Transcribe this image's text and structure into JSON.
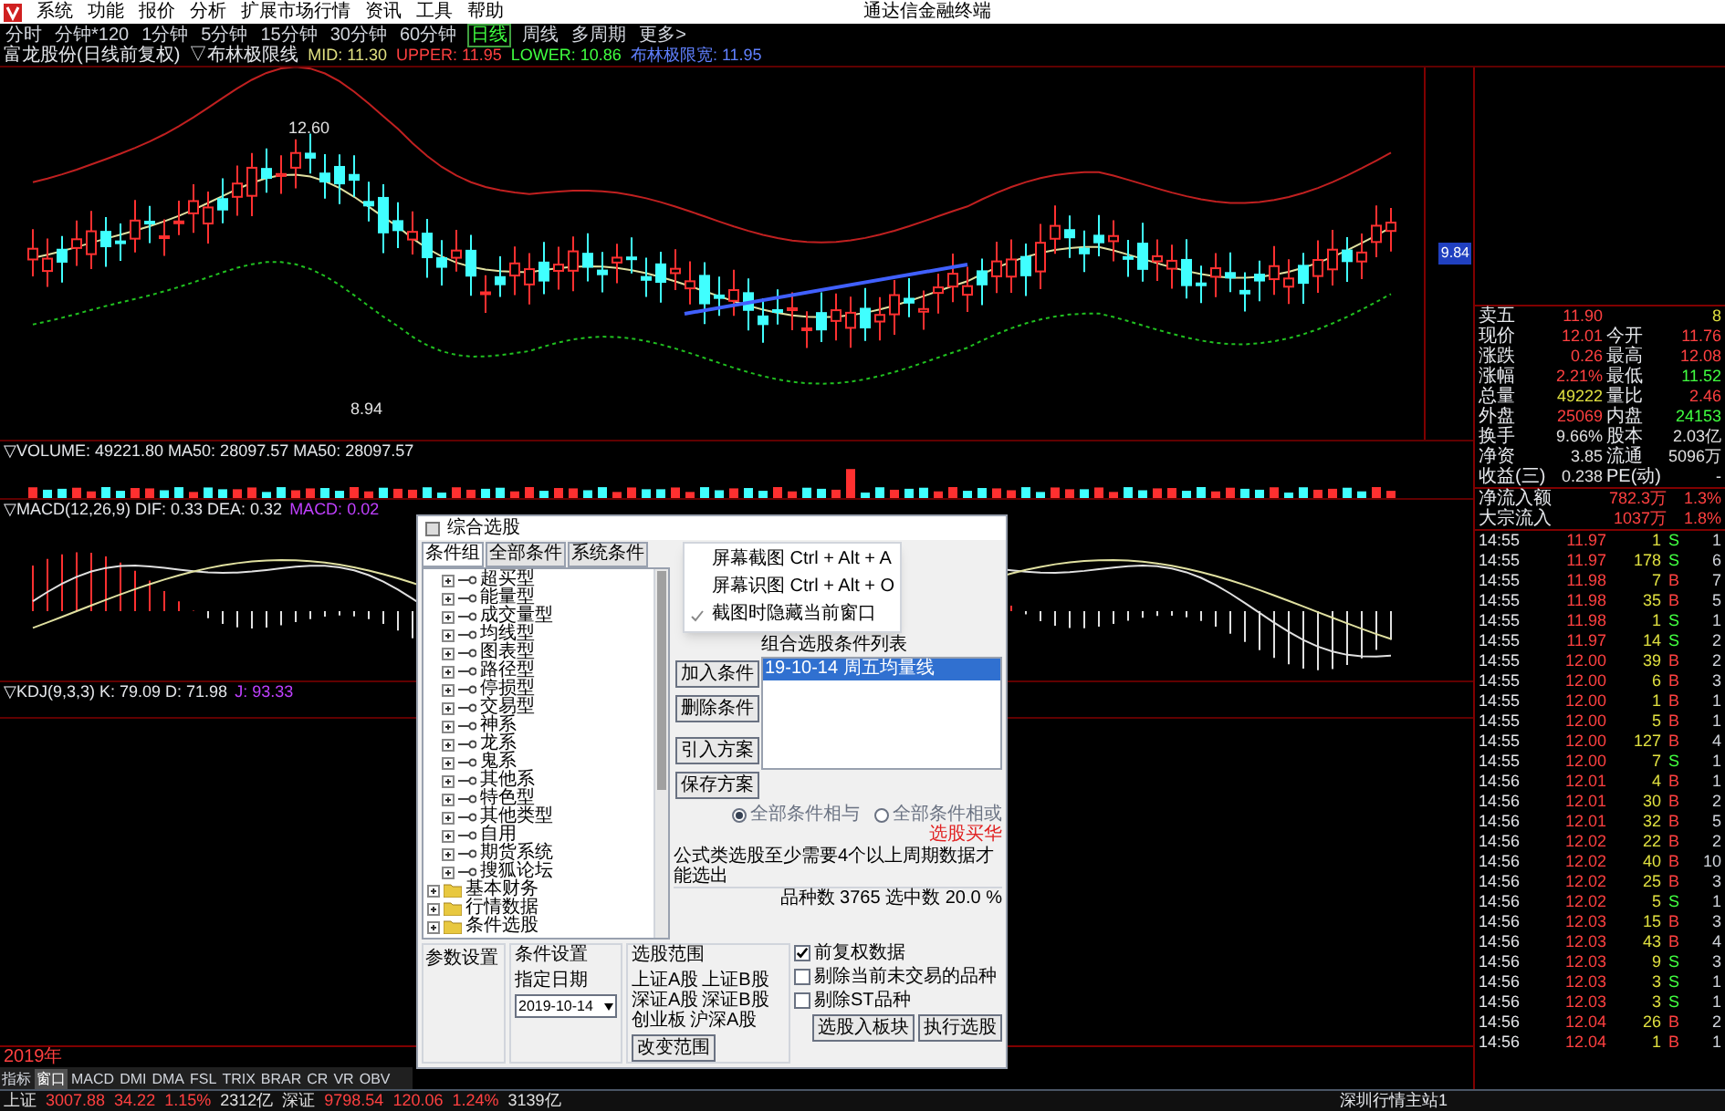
{
  "menu": {
    "items": [
      "系统",
      "功能",
      "报价",
      "分析",
      "扩展市场行情",
      "资讯",
      "工具",
      "帮助"
    ],
    "app_title": "通达信金融终端"
  },
  "periods": [
    {
      "label": "分时",
      "selected": false
    },
    {
      "label": "分钟*120",
      "selected": false
    },
    {
      "label": "1分钟",
      "selected": false
    },
    {
      "label": "5分钟",
      "selected": false
    },
    {
      "label": "15分钟",
      "selected": false
    },
    {
      "label": "30分钟",
      "selected": false
    },
    {
      "label": "60分钟",
      "selected": false
    },
    {
      "label": "日线",
      "selected": true
    },
    {
      "label": "周线",
      "selected": false
    },
    {
      "label": "多周期",
      "selected": false
    },
    {
      "label": "更多>",
      "selected": false
    }
  ],
  "indicator_bar": {
    "stock": "富龙股份(日线前复权)",
    "indicator": "▽布林极限线",
    "values": [
      {
        "text": "MID: 11.30",
        "color": "#e0e080"
      },
      {
        "text": "UPPER: 11.95",
        "color": "#ff4040"
      },
      {
        "text": "LOWER: 10.86",
        "color": "#40ff40"
      },
      {
        "text": "布林极限宽: 11.95",
        "color": "#6080ff"
      }
    ]
  },
  "chart": {
    "high_label": "12.60",
    "low_label": "8.94",
    "marker": "9.84"
  },
  "volume_pane": {
    "title": "▽VOLUME: 49221.80  MA50: 28097.57  MA50: 28097.57"
  },
  "macd_pane": {
    "title": "▽MACD(12,26,9) DIF: 0.33 DEA: 0.32",
    "value": "MACD: 0.02"
  },
  "kdj_pane": {
    "title": "▽KDJ(9,3,3) K: 79.09 D: 71.98",
    "value": "J: 93.33"
  },
  "date_axis": "2019年",
  "indicator_tabs": [
    {
      "label": "指标",
      "selected": false
    },
    {
      "label": "窗口",
      "selected": true
    },
    {
      "label": "MACD",
      "selected": false
    },
    {
      "label": "DMI",
      "selected": false
    },
    {
      "label": "DMA",
      "selected": false
    },
    {
      "label": "FSL",
      "selected": false
    },
    {
      "label": "TRIX",
      "selected": false
    },
    {
      "label": "BRAR",
      "selected": false
    },
    {
      "label": "CR",
      "selected": false
    },
    {
      "label": "VR",
      "selected": false
    },
    {
      "label": "OBV",
      "selected": false
    }
  ],
  "status_bar": {
    "items": [
      {
        "text": "上证",
        "color": "#e0e0e0"
      },
      {
        "text": "3007.88",
        "color": "#ff4040"
      },
      {
        "text": "34.22",
        "color": "#ff4040"
      },
      {
        "text": "1.15%",
        "color": "#ff4040"
      },
      {
        "text": "2312亿",
        "color": "#e0e0e0"
      },
      {
        "text": "深证",
        "color": "#e0e0e0"
      },
      {
        "text": "9798.54",
        "color": "#ff4040"
      },
      {
        "text": "120.06",
        "color": "#ff4040"
      },
      {
        "text": "1.24%",
        "color": "#ff4040"
      },
      {
        "text": "3139亿",
        "color": "#e0e0e0"
      }
    ],
    "server": "深圳行情主站1"
  },
  "quote": [
    {
      "label": "卖五",
      "value": {
        "text": "11.90",
        "color": "#ff4040"
      },
      "value2": {
        "text": "8",
        "color": "#e0e040"
      }
    },
    {
      "label": "现价",
      "value": {
        "text": "12.01",
        "color": "#ff4040"
      },
      "label2": "今开",
      "value2": {
        "text": "11.76",
        "color": "#ff4040"
      }
    },
    {
      "label": "涨跌",
      "value": {
        "text": "0.26",
        "color": "#ff4040"
      },
      "label2": "最高",
      "value2": {
        "text": "12.08",
        "color": "#ff4040"
      }
    },
    {
      "label": "涨幅",
      "value": {
        "text": "2.21%",
        "color": "#ff4040"
      },
      "label2": "最低",
      "value2": {
        "text": "11.52",
        "color": "#40ff40"
      }
    },
    {
      "label": "总量",
      "value": {
        "text": "49222",
        "color": "#e0e040"
      },
      "label2": "量比",
      "value2": {
        "text": "2.46",
        "color": "#ff4040"
      }
    },
    {
      "label": "外盘",
      "value": {
        "text": "25069",
        "color": "#ff4040"
      },
      "label2": "内盘",
      "value2": {
        "text": "24153",
        "color": "#40ff40"
      }
    },
    {
      "label": "换手",
      "value": {
        "text": "9.66%",
        "color": "#e0e0e0"
      },
      "label2": "股本",
      "value2": {
        "text": "2.03亿",
        "color": "#e0e0e0"
      }
    },
    {
      "label": "净资",
      "value": {
        "text": "3.85",
        "color": "#e0e0e0"
      },
      "label2": "流通",
      "value2": {
        "text": "5096万",
        "color": "#e0e0e0"
      }
    },
    {
      "label": "收益(三)",
      "value": {
        "text": "0.238",
        "color": "#e0e0e0"
      },
      "label2": "PE(动)",
      "value2": {
        "text": "-"
      }
    }
  ],
  "flows": [
    {
      "label": "净流入额",
      "value": "782.3万",
      "share": "1.3%"
    },
    {
      "label": "大宗流入",
      "value": "1037万",
      "share": "1.8%"
    }
  ],
  "ticks": [
    {
      "time": "14:55",
      "price": "11.97",
      "volume": "1",
      "side": "S",
      "kind": "sell",
      "count": "1"
    },
    {
      "time": "14:55",
      "price": "11.97",
      "volume": "178",
      "side": "S",
      "kind": "sell",
      "count": "6"
    },
    {
      "time": "14:55",
      "price": "11.98",
      "volume": "7",
      "side": "B",
      "kind": "buy",
      "count": "7"
    },
    {
      "time": "14:55",
      "price": "11.98",
      "volume": "35",
      "side": "B",
      "kind": "buy",
      "count": "5"
    },
    {
      "time": "14:55",
      "price": "11.98",
      "volume": "1",
      "side": "S",
      "kind": "sell",
      "count": "1"
    },
    {
      "time": "14:55",
      "price": "11.97",
      "volume": "14",
      "side": "S",
      "kind": "sell",
      "count": "2"
    },
    {
      "time": "14:55",
      "price": "12.00",
      "volume": "39",
      "side": "B",
      "kind": "buy",
      "count": "2"
    },
    {
      "time": "14:55",
      "price": "12.00",
      "volume": "6",
      "side": "B",
      "kind": "buy",
      "count": "3"
    },
    {
      "time": "14:55",
      "price": "12.00",
      "volume": "1",
      "side": "B",
      "kind": "buy",
      "count": "1"
    },
    {
      "time": "14:55",
      "price": "12.00",
      "volume": "5",
      "side": "B",
      "kind": "buy",
      "count": "1"
    },
    {
      "time": "14:55",
      "price": "12.00",
      "volume": "127",
      "side": "B",
      "kind": "buy",
      "count": "4"
    },
    {
      "time": "14:55",
      "price": "12.00",
      "volume": "7",
      "side": "S",
      "kind": "sell",
      "count": "1"
    },
    {
      "time": "14:56",
      "price": "12.01",
      "volume": "4",
      "side": "B",
      "kind": "buy",
      "count": "1"
    },
    {
      "time": "14:56",
      "price": "12.01",
      "volume": "30",
      "side": "B",
      "kind": "buy",
      "count": "2"
    },
    {
      "time": "14:56",
      "price": "12.01",
      "volume": "32",
      "side": "B",
      "kind": "buy",
      "count": "5"
    },
    {
      "time": "14:56",
      "price": "12.02",
      "volume": "22",
      "side": "B",
      "kind": "buy",
      "count": "2"
    },
    {
      "time": "14:56",
      "price": "12.02",
      "volume": "40",
      "side": "B",
      "kind": "buy",
      "count": "10"
    },
    {
      "time": "14:56",
      "price": "12.02",
      "volume": "25",
      "side": "B",
      "kind": "buy",
      "count": "3"
    },
    {
      "time": "14:56",
      "price": "12.02",
      "volume": "5",
      "side": "S",
      "kind": "sell",
      "count": "1"
    },
    {
      "time": "14:56",
      "price": "12.03",
      "volume": "15",
      "side": "B",
      "kind": "buy",
      "count": "3"
    },
    {
      "time": "14:56",
      "price": "12.03",
      "volume": "43",
      "side": "B",
      "kind": "buy",
      "count": "4"
    },
    {
      "time": "14:56",
      "price": "12.03",
      "volume": "9",
      "side": "S",
      "kind": "sell",
      "count": "3"
    },
    {
      "time": "14:56",
      "price": "12.03",
      "volume": "3",
      "side": "S",
      "kind": "sell",
      "count": "1"
    },
    {
      "time": "14:56",
      "price": "12.03",
      "volume": "3",
      "side": "S",
      "kind": "sell",
      "count": "1"
    },
    {
      "time": "14:56",
      "price": "12.04",
      "volume": "26",
      "side": "B",
      "kind": "buy",
      "count": "2"
    },
    {
      "time": "14:56",
      "price": "12.04",
      "volume": "1",
      "side": "B",
      "kind": "buy",
      "count": "1"
    }
  ],
  "dialog": {
    "title": "综合选股",
    "tabs": [
      {
        "label": "条件组",
        "selected": true
      },
      {
        "label": "全部条件",
        "selected": false
      },
      {
        "label": "系统条件",
        "selected": false
      }
    ],
    "tree": [
      {
        "label": "超买型",
        "kind": "formula"
      },
      {
        "label": "能量型",
        "kind": "formula"
      },
      {
        "label": "成交量型",
        "kind": "formula"
      },
      {
        "label": "均线型",
        "kind": "formula"
      },
      {
        "label": "图表型",
        "kind": "formula"
      },
      {
        "label": "路径型",
        "kind": "formula"
      },
      {
        "label": "停损型",
        "kind": "formula"
      },
      {
        "label": "交易型",
        "kind": "formula"
      },
      {
        "label": "神系",
        "kind": "formula"
      },
      {
        "label": "龙系",
        "kind": "formula"
      },
      {
        "label": "鬼系",
        "kind": "formula"
      },
      {
        "label": "其他系",
        "kind": "formula"
      },
      {
        "label": "特色型",
        "kind": "formula"
      },
      {
        "label": "其他类型",
        "kind": "formula"
      },
      {
        "label": "自用",
        "kind": "formula"
      },
      {
        "label": "期货系统",
        "kind": "formula"
      },
      {
        "label": "搜狐论坛",
        "kind": "formula"
      },
      {
        "label": "基本财务",
        "kind": "folder"
      },
      {
        "label": "行情数据",
        "kind": "folder"
      },
      {
        "label": "条件选股",
        "kind": "folder"
      }
    ],
    "buttons": [
      "加入条件",
      "删除条件",
      "引入方案",
      "保存方案"
    ],
    "list_title": "组合选股条件列表",
    "list": [
      {
        "label": "19-10-14 周五均量线",
        "selected": true
      }
    ],
    "radios": [
      {
        "label": "全部条件相与",
        "selected": true
      },
      {
        "label": "全部条件相或",
        "selected": false
      }
    ],
    "buy_link": "选股买华",
    "note": "公式类选股至少需要4个以上周期数据才能选出",
    "counts": "品种数 3765   选中数 20.0 %",
    "params_group": "参数设置",
    "cond_group": "条件设置",
    "date_label": "指定日期",
    "date_value": "2019-10-14",
    "range_group": "选股范围",
    "range_items": [
      "上证A股",
      "上证B股",
      "深证A股",
      "深证B股",
      "创业板",
      "沪深A股"
    ],
    "range_button": "改变范围",
    "checks": [
      {
        "label": "前复权数据",
        "checked": true
      },
      {
        "label": "剔除当前未交易的品种",
        "checked": false
      },
      {
        "label": "剔除ST品种",
        "checked": false
      }
    ],
    "actions": [
      "选股入板块",
      "执行选股"
    ]
  },
  "context_menu": [
    {
      "label": "屏幕截图",
      "shortcut": "Ctrl + Alt + A",
      "checked": false
    },
    {
      "label": "屏幕识图",
      "shortcut": "Ctrl + Alt + O",
      "checked": false
    },
    {
      "label": "截图时隐藏当前窗口",
      "checked": true
    }
  ]
}
